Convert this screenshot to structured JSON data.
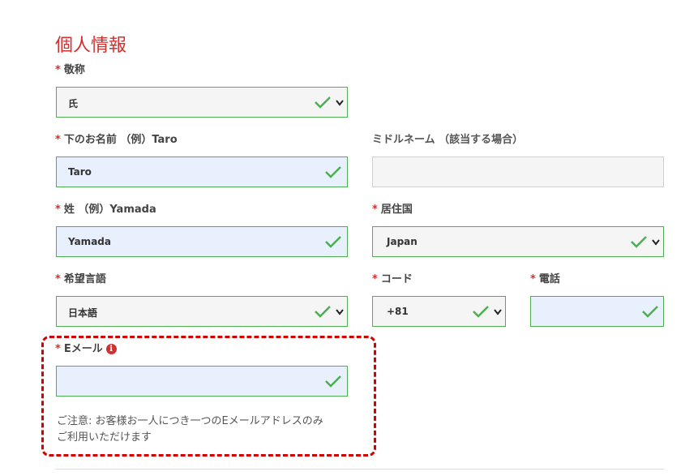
{
  "section_title": "個人情報",
  "required_mark": "*",
  "fields": {
    "salutation": {
      "label": "敬称",
      "value": "氏"
    },
    "first_name": {
      "label": "下のお名前 （例）Taro",
      "value": "Taro"
    },
    "middle_name": {
      "label": "ミドルネーム （該当する場合）",
      "value": ""
    },
    "last_name": {
      "label": "姓 （例）Yamada",
      "value": "Yamada"
    },
    "country": {
      "label": "居住国",
      "value": "Japan"
    },
    "language": {
      "label": "希望言語",
      "value": "日本語"
    },
    "code": {
      "label": "コード",
      "value": "+81"
    },
    "phone": {
      "label": "電話",
      "value": ""
    },
    "email": {
      "label": "Eメール",
      "value": "",
      "info_icon": "i"
    }
  },
  "email_note": {
    "line1": "ご注意: お客様お一人につき一つのEメールアドレスのみ",
    "line2": "ご利用いただけます"
  },
  "colors": {
    "accent": "#d32f2f",
    "valid": "#4caf50",
    "highlight": "#d50000"
  }
}
